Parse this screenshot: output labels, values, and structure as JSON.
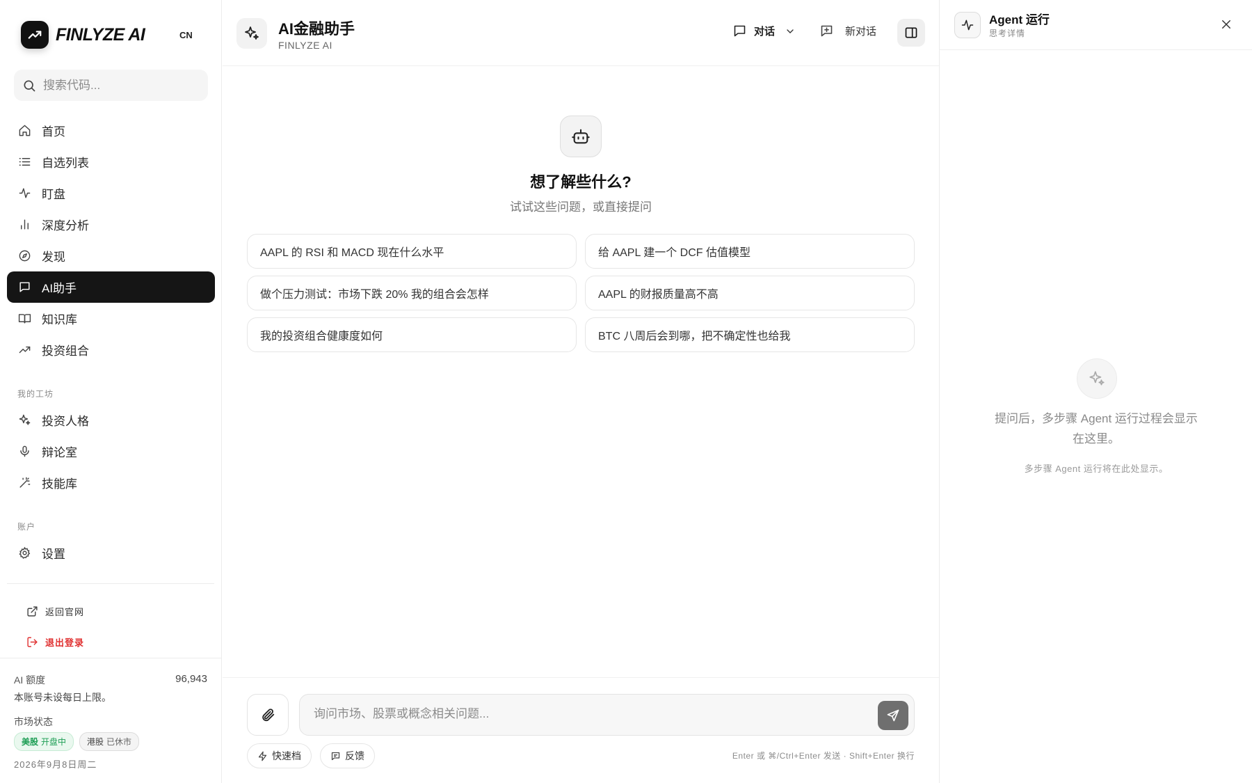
{
  "brand": {
    "name": "FINLYZE AI",
    "lang": "CN"
  },
  "search": {
    "placeholder": "搜索代码..."
  },
  "nav": {
    "items": [
      {
        "label": "首页",
        "icon": "home-icon"
      },
      {
        "label": "自选列表",
        "icon": "list-icon"
      },
      {
        "label": "盯盘",
        "icon": "activity-icon"
      },
      {
        "label": "深度分析",
        "icon": "bar-chart-icon"
      },
      {
        "label": "发现",
        "icon": "compass-icon"
      },
      {
        "label": "AI助手",
        "icon": "message-icon"
      },
      {
        "label": "知识库",
        "icon": "book-icon"
      },
      {
        "label": "投资组合",
        "icon": "trending-up-icon"
      }
    ],
    "active": "AI助手"
  },
  "workshop": {
    "label": "我的工坊",
    "items": [
      {
        "label": "投资人格",
        "icon": "sparkles-icon"
      },
      {
        "label": "辩论室",
        "icon": "mic-icon"
      },
      {
        "label": "技能库",
        "icon": "wand-icon"
      }
    ]
  },
  "account": {
    "label": "账户",
    "items": [
      {
        "label": "设置",
        "icon": "gear-icon"
      }
    ]
  },
  "footer_links": {
    "back": "返回官网",
    "logout": "退出登录"
  },
  "quota": {
    "label": "AI 额度",
    "value": "96,943",
    "note": "本账号未设每日上限。"
  },
  "market": {
    "label": "市场状态",
    "us": {
      "name": "美股",
      "status": "开盘中"
    },
    "hk": {
      "name": "港股",
      "status": "已休市"
    },
    "date": "2026年9月8日周二"
  },
  "header": {
    "title": "AI金融助手",
    "subtitle": "FINLYZE AI",
    "mode_label": "对话",
    "new_chat_label": "新对话"
  },
  "hero": {
    "title": "想了解些什么?",
    "subtitle": "试试这些问题，或直接提问"
  },
  "suggestions": [
    "AAPL 的 RSI 和 MACD 现在什么水平",
    "给 AAPL 建一个 DCF 估值模型",
    "做个压力测试：市场下跌 20% 我的组合会怎样",
    "AAPL 的财报质量高不高",
    "我的投资组合健康度如何",
    "BTC 八周后会到哪，把不确定性也给我"
  ],
  "composer": {
    "placeholder": "询问市场、股票或概念相关问题...",
    "quick_label": "快速档",
    "feedback_label": "反馈",
    "hint": "Enter 或 ⌘/Ctrl+Enter 发送 · Shift+Enter 换行"
  },
  "agent": {
    "title": "Agent 运行",
    "subtitle": "思考详情",
    "empty_message": "提问后，多步骤 Agent 运行过程会显示在这里。",
    "empty_note": "多步骤 Agent 运行将在此处显示。"
  },
  "colors": {
    "accent": "#151515",
    "open_green": "#1e9e55",
    "logout_red": "#e03131"
  }
}
